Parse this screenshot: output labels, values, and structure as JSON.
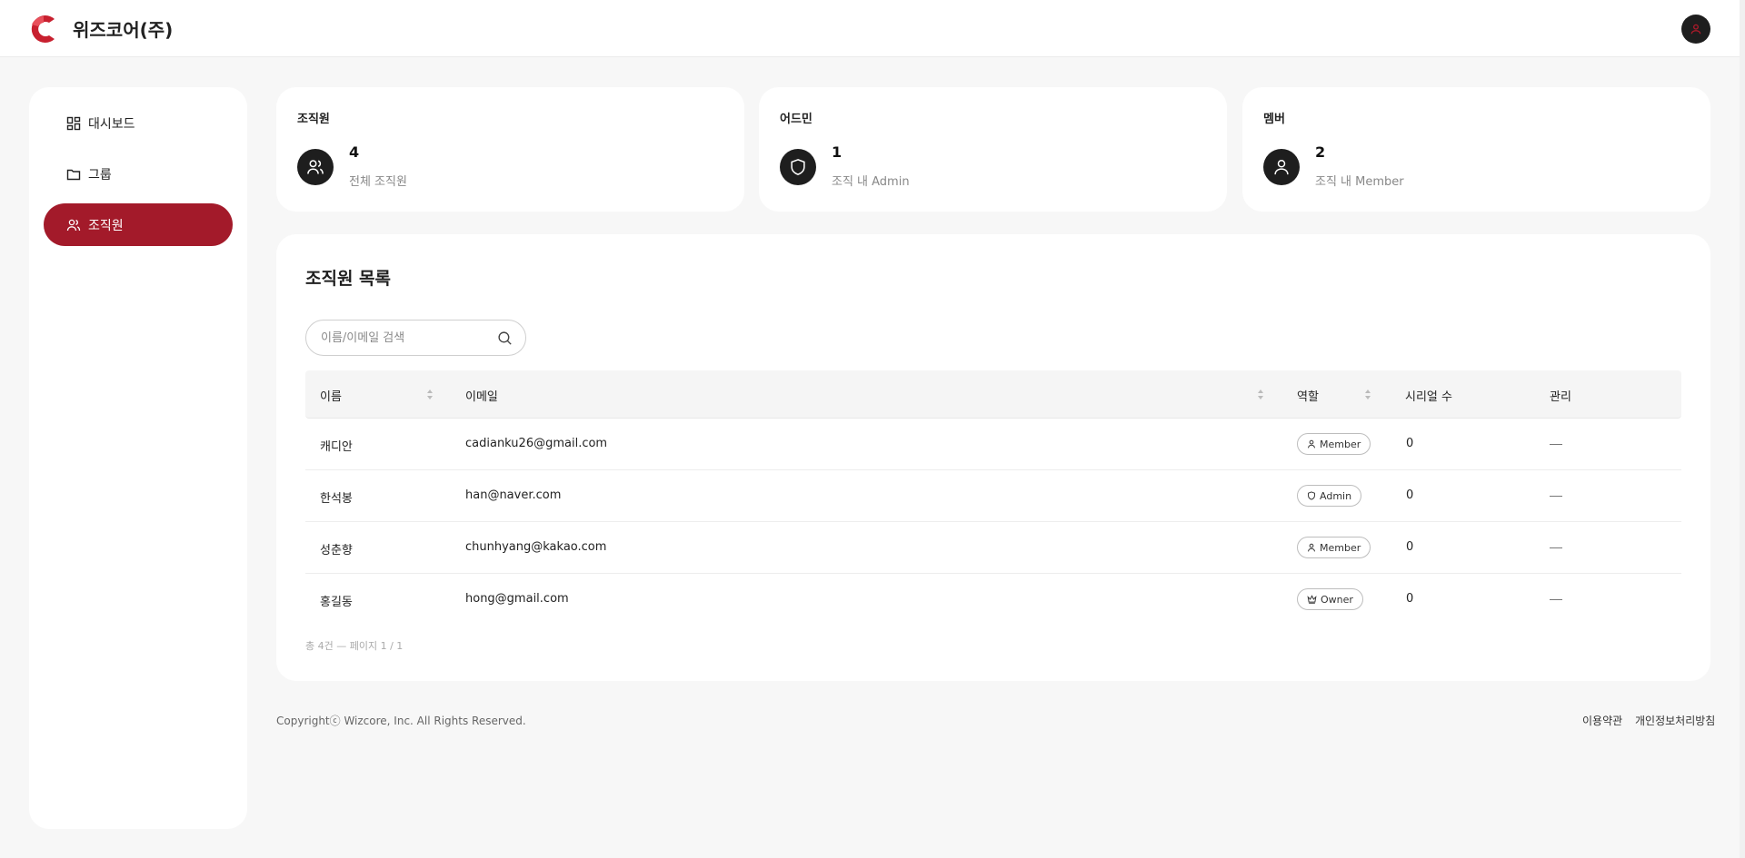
{
  "header": {
    "org_name": "위즈코어(주)"
  },
  "sidebar": {
    "items": [
      {
        "label": "대시보드",
        "icon": "dashboard-icon"
      },
      {
        "label": "그룹",
        "icon": "folder-icon"
      },
      {
        "label": "조직원",
        "icon": "users-icon",
        "active": true
      }
    ]
  },
  "stats": [
    {
      "title": "조직원",
      "value": "4",
      "desc": "전체 조직원",
      "icon": "users-icon"
    },
    {
      "title": "어드민",
      "value": "1",
      "desc": "조직 내 Admin",
      "icon": "shield-icon"
    },
    {
      "title": "멤버",
      "value": "2",
      "desc": "조직 내 Member",
      "icon": "user-icon"
    }
  ],
  "members": {
    "title": "조직원 목록",
    "search_placeholder": "이름/이메일 검색",
    "columns": {
      "name": "이름",
      "email": "이메일",
      "role": "역할",
      "serial": "시리얼 수",
      "manage": "관리"
    },
    "rows": [
      {
        "name": "캐디안",
        "email": "cadianku26@gmail.com",
        "role": "Member",
        "serial": "0"
      },
      {
        "name": "한석봉",
        "email": "han@naver.com",
        "role": "Admin",
        "serial": "0"
      },
      {
        "name": "성춘향",
        "email": "chunhyang@kakao.com",
        "role": "Member",
        "serial": "0"
      },
      {
        "name": "홍길동",
        "email": "hong@gmail.com",
        "role": "Owner",
        "serial": "0"
      }
    ],
    "pager": "총 4건 — 페이지 1 / 1"
  },
  "footer": {
    "copyright": "Copyrightⓒ Wizcore, Inc. All Rights Reserved.",
    "terms": "이용약관",
    "privacy": "개인정보처리방침"
  },
  "colors": {
    "accent": "#a31a2a",
    "dark": "#1e1e1e"
  }
}
